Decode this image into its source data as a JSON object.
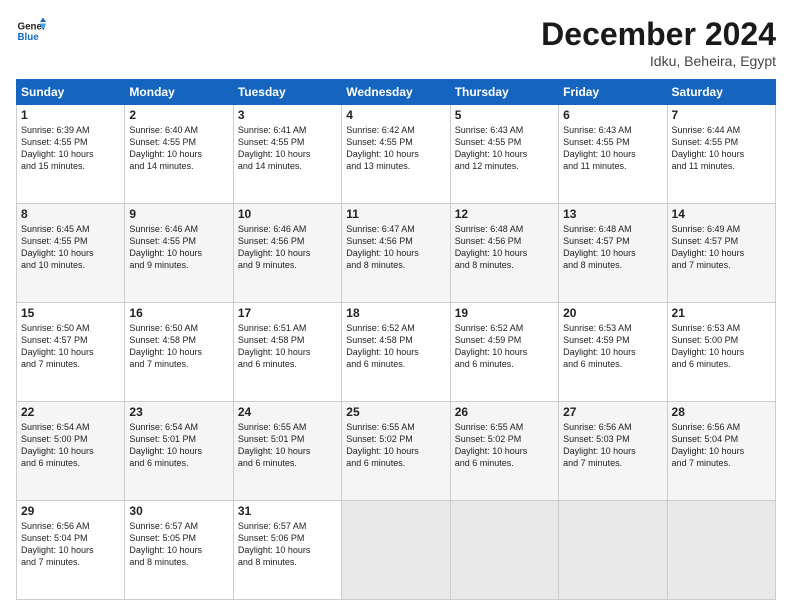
{
  "header": {
    "logo_line1": "General",
    "logo_line2": "Blue",
    "month_title": "December 2024",
    "location": "Idku, Beheira, Egypt"
  },
  "weekdays": [
    "Sunday",
    "Monday",
    "Tuesday",
    "Wednesday",
    "Thursday",
    "Friday",
    "Saturday"
  ],
  "weeks": [
    [
      {
        "day": "1",
        "info": "Sunrise: 6:39 AM\nSunset: 4:55 PM\nDaylight: 10 hours\nand 15 minutes."
      },
      {
        "day": "2",
        "info": "Sunrise: 6:40 AM\nSunset: 4:55 PM\nDaylight: 10 hours\nand 14 minutes."
      },
      {
        "day": "3",
        "info": "Sunrise: 6:41 AM\nSunset: 4:55 PM\nDaylight: 10 hours\nand 14 minutes."
      },
      {
        "day": "4",
        "info": "Sunrise: 6:42 AM\nSunset: 4:55 PM\nDaylight: 10 hours\nand 13 minutes."
      },
      {
        "day": "5",
        "info": "Sunrise: 6:43 AM\nSunset: 4:55 PM\nDaylight: 10 hours\nand 12 minutes."
      },
      {
        "day": "6",
        "info": "Sunrise: 6:43 AM\nSunset: 4:55 PM\nDaylight: 10 hours\nand 11 minutes."
      },
      {
        "day": "7",
        "info": "Sunrise: 6:44 AM\nSunset: 4:55 PM\nDaylight: 10 hours\nand 11 minutes."
      }
    ],
    [
      {
        "day": "8",
        "info": "Sunrise: 6:45 AM\nSunset: 4:55 PM\nDaylight: 10 hours\nand 10 minutes."
      },
      {
        "day": "9",
        "info": "Sunrise: 6:46 AM\nSunset: 4:55 PM\nDaylight: 10 hours\nand 9 minutes."
      },
      {
        "day": "10",
        "info": "Sunrise: 6:46 AM\nSunset: 4:56 PM\nDaylight: 10 hours\nand 9 minutes."
      },
      {
        "day": "11",
        "info": "Sunrise: 6:47 AM\nSunset: 4:56 PM\nDaylight: 10 hours\nand 8 minutes."
      },
      {
        "day": "12",
        "info": "Sunrise: 6:48 AM\nSunset: 4:56 PM\nDaylight: 10 hours\nand 8 minutes."
      },
      {
        "day": "13",
        "info": "Sunrise: 6:48 AM\nSunset: 4:57 PM\nDaylight: 10 hours\nand 8 minutes."
      },
      {
        "day": "14",
        "info": "Sunrise: 6:49 AM\nSunset: 4:57 PM\nDaylight: 10 hours\nand 7 minutes."
      }
    ],
    [
      {
        "day": "15",
        "info": "Sunrise: 6:50 AM\nSunset: 4:57 PM\nDaylight: 10 hours\nand 7 minutes."
      },
      {
        "day": "16",
        "info": "Sunrise: 6:50 AM\nSunset: 4:58 PM\nDaylight: 10 hours\nand 7 minutes."
      },
      {
        "day": "17",
        "info": "Sunrise: 6:51 AM\nSunset: 4:58 PM\nDaylight: 10 hours\nand 6 minutes."
      },
      {
        "day": "18",
        "info": "Sunrise: 6:52 AM\nSunset: 4:58 PM\nDaylight: 10 hours\nand 6 minutes."
      },
      {
        "day": "19",
        "info": "Sunrise: 6:52 AM\nSunset: 4:59 PM\nDaylight: 10 hours\nand 6 minutes."
      },
      {
        "day": "20",
        "info": "Sunrise: 6:53 AM\nSunset: 4:59 PM\nDaylight: 10 hours\nand 6 minutes."
      },
      {
        "day": "21",
        "info": "Sunrise: 6:53 AM\nSunset: 5:00 PM\nDaylight: 10 hours\nand 6 minutes."
      }
    ],
    [
      {
        "day": "22",
        "info": "Sunrise: 6:54 AM\nSunset: 5:00 PM\nDaylight: 10 hours\nand 6 minutes."
      },
      {
        "day": "23",
        "info": "Sunrise: 6:54 AM\nSunset: 5:01 PM\nDaylight: 10 hours\nand 6 minutes."
      },
      {
        "day": "24",
        "info": "Sunrise: 6:55 AM\nSunset: 5:01 PM\nDaylight: 10 hours\nand 6 minutes."
      },
      {
        "day": "25",
        "info": "Sunrise: 6:55 AM\nSunset: 5:02 PM\nDaylight: 10 hours\nand 6 minutes."
      },
      {
        "day": "26",
        "info": "Sunrise: 6:55 AM\nSunset: 5:02 PM\nDaylight: 10 hours\nand 6 minutes."
      },
      {
        "day": "27",
        "info": "Sunrise: 6:56 AM\nSunset: 5:03 PM\nDaylight: 10 hours\nand 7 minutes."
      },
      {
        "day": "28",
        "info": "Sunrise: 6:56 AM\nSunset: 5:04 PM\nDaylight: 10 hours\nand 7 minutes."
      }
    ],
    [
      {
        "day": "29",
        "info": "Sunrise: 6:56 AM\nSunset: 5:04 PM\nDaylight: 10 hours\nand 7 minutes."
      },
      {
        "day": "30",
        "info": "Sunrise: 6:57 AM\nSunset: 5:05 PM\nDaylight: 10 hours\nand 8 minutes."
      },
      {
        "day": "31",
        "info": "Sunrise: 6:57 AM\nSunset: 5:06 PM\nDaylight: 10 hours\nand 8 minutes."
      },
      {
        "day": "",
        "info": ""
      },
      {
        "day": "",
        "info": ""
      },
      {
        "day": "",
        "info": ""
      },
      {
        "day": "",
        "info": ""
      }
    ]
  ]
}
